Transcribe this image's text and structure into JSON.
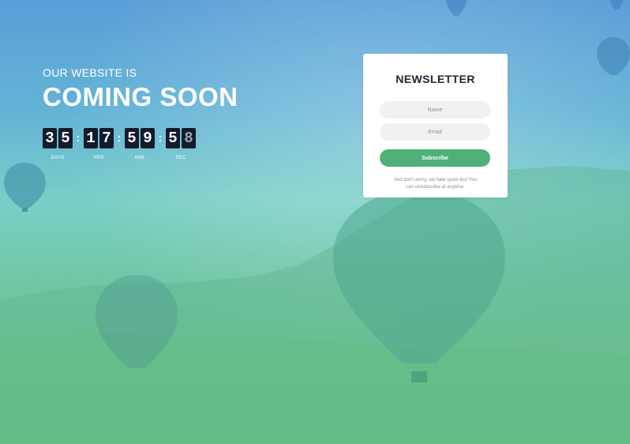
{
  "hero": {
    "subtitle": "OUR WEBSITE IS",
    "title": "COMING SOON"
  },
  "countdown": {
    "separator": ":",
    "days": {
      "d1": "3",
      "d2": "5",
      "label": "DAYS"
    },
    "hours": {
      "d1": "1",
      "d2": "7",
      "label": "HRS"
    },
    "minutes": {
      "d1": "5",
      "d2": "9",
      "label": "MIN"
    },
    "seconds": {
      "d1": "5",
      "d2": "8",
      "label": "SEC"
    }
  },
  "newsletter": {
    "title": "NEWSLETTER",
    "name_placeholder": "Name",
    "email_placeholder": "Email",
    "name_value": "",
    "email_value": "",
    "subscribe_label": "Subscribe",
    "note_line1": "And don't worry, we hate spam too! You",
    "note_line2": "can unsubscribe at anytime."
  },
  "colors": {
    "accent": "#4fb177",
    "digit_bg": "#141b2c",
    "sky_top": "#5a9fd8",
    "field_bottom": "#6cc57d"
  }
}
